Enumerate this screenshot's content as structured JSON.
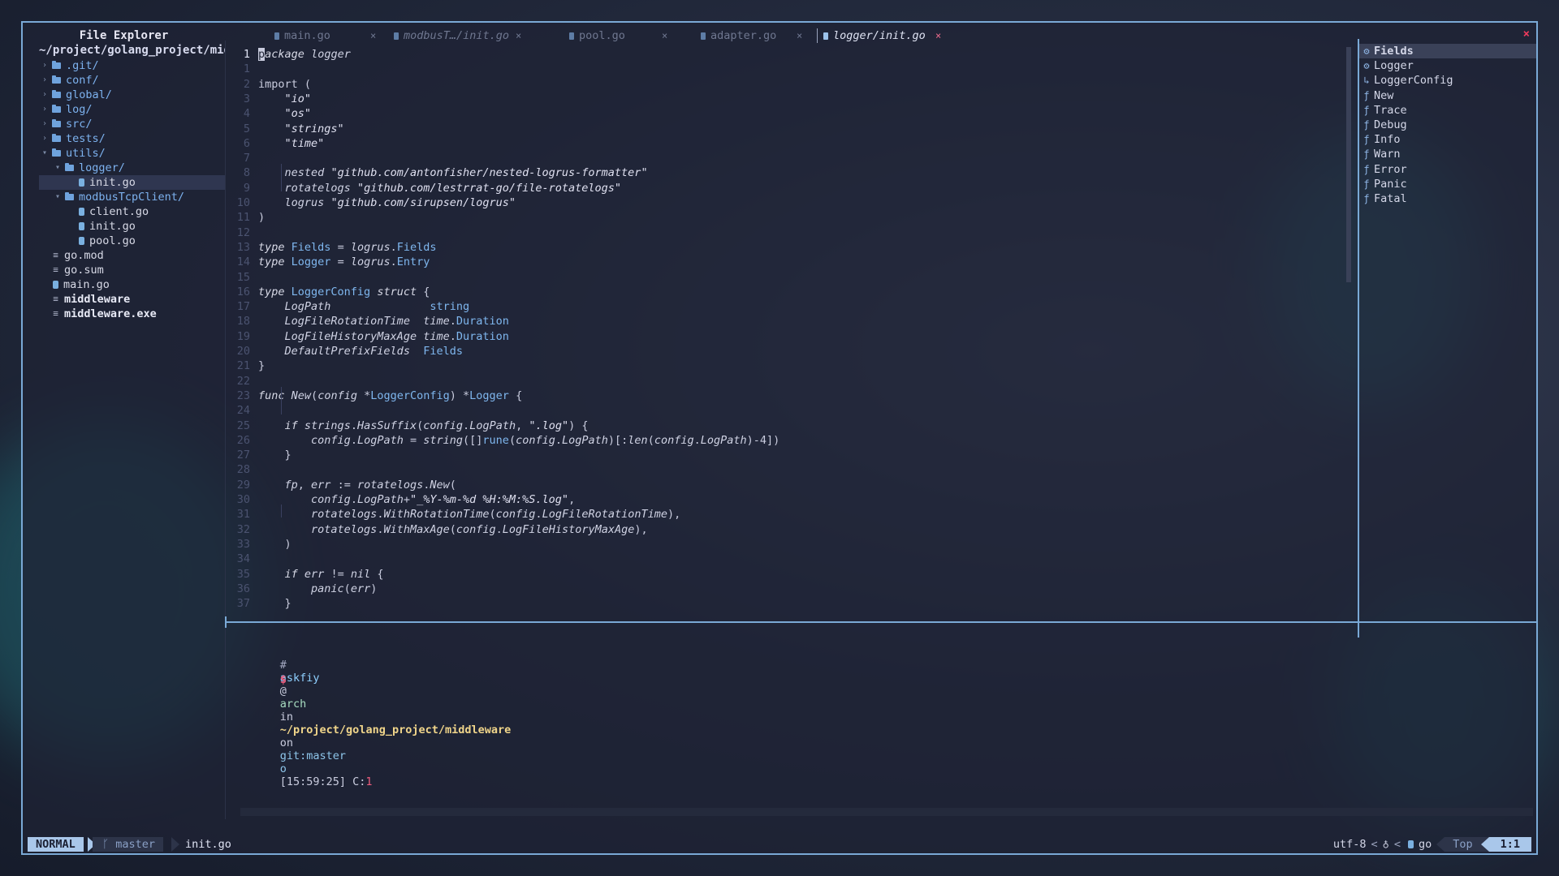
{
  "explorer": {
    "title": "File Explorer",
    "path": "~/project/golang_project/mid",
    "items": [
      {
        "label": ".git/",
        "type": "dir",
        "depth": 0,
        "open": false
      },
      {
        "label": "conf/",
        "type": "dir",
        "depth": 0,
        "open": false
      },
      {
        "label": "global/",
        "type": "dir",
        "depth": 0,
        "open": false
      },
      {
        "label": "log/",
        "type": "dir",
        "depth": 0,
        "open": false
      },
      {
        "label": "src/",
        "type": "dir",
        "depth": 0,
        "open": false
      },
      {
        "label": "tests/",
        "type": "dir",
        "depth": 0,
        "open": false
      },
      {
        "label": "utils/",
        "type": "dir",
        "depth": 0,
        "open": true
      },
      {
        "label": "logger/",
        "type": "dir",
        "depth": 1,
        "open": true
      },
      {
        "label": "init.go",
        "type": "go",
        "depth": 2,
        "selected": true
      },
      {
        "label": "modbusTcpClient/",
        "type": "dir",
        "depth": 1,
        "open": true
      },
      {
        "label": "client.go",
        "type": "go",
        "depth": 2
      },
      {
        "label": "init.go",
        "type": "go",
        "depth": 2
      },
      {
        "label": "pool.go",
        "type": "go",
        "depth": 2
      },
      {
        "label": "go.mod",
        "type": "file",
        "depth": 0
      },
      {
        "label": "go.sum",
        "type": "file",
        "depth": 0
      },
      {
        "label": "main.go",
        "type": "go",
        "depth": 0
      },
      {
        "label": "middleware",
        "type": "file",
        "depth": 0,
        "bold": true
      },
      {
        "label": "middleware.exe",
        "type": "file",
        "depth": 0,
        "bold": true
      }
    ]
  },
  "tabs": [
    {
      "label": "main.go",
      "active": false
    },
    {
      "label": "modbusT…/init.go",
      "active": false
    },
    {
      "label": "pool.go",
      "active": false
    },
    {
      "label": "adapter.go",
      "active": false
    },
    {
      "label": "logger/init.go",
      "active": true
    }
  ],
  "tab_close_glyph": "×",
  "window_close_glyph": "×",
  "code": [
    {
      "n": "1",
      "cur": true,
      "t": [
        [
          "cursor",
          "p"
        ],
        [
          "kw",
          "ackage"
        ],
        [
          "plain",
          " "
        ],
        [
          "id",
          "logger"
        ]
      ]
    },
    {
      "n": "1",
      "t": []
    },
    {
      "n": "2",
      "t": [
        [
          "plain",
          "import ("
        ]
      ]
    },
    {
      "n": "3",
      "t": [
        [
          "plain",
          "    "
        ],
        [
          "str",
          "\"io\""
        ]
      ]
    },
    {
      "n": "4",
      "t": [
        [
          "plain",
          "    "
        ],
        [
          "str",
          "\"os\""
        ]
      ]
    },
    {
      "n": "5",
      "t": [
        [
          "plain",
          "    "
        ],
        [
          "str",
          "\"strings\""
        ]
      ]
    },
    {
      "n": "6",
      "t": [
        [
          "plain",
          "    "
        ],
        [
          "str",
          "\"time\""
        ]
      ]
    },
    {
      "n": "7",
      "t": []
    },
    {
      "n": "8",
      "t": [
        [
          "plain",
          "    "
        ],
        [
          "id",
          "nested"
        ],
        [
          "plain",
          " "
        ],
        [
          "str",
          "\"github.com/antonfisher/nested-logrus-formatter\""
        ]
      ]
    },
    {
      "n": "9",
      "t": [
        [
          "plain",
          "    "
        ],
        [
          "id",
          "rotatelogs"
        ],
        [
          "plain",
          " "
        ],
        [
          "str",
          "\"github.com/lestrrat-go/file-rotatelogs\""
        ]
      ]
    },
    {
      "n": "10",
      "t": [
        [
          "plain",
          "    "
        ],
        [
          "id",
          "logrus"
        ],
        [
          "plain",
          " "
        ],
        [
          "str",
          "\"github.com/sirupsen/logrus\""
        ]
      ]
    },
    {
      "n": "11",
      "t": [
        [
          "plain",
          ")"
        ]
      ]
    },
    {
      "n": "12",
      "t": []
    },
    {
      "n": "13",
      "t": [
        [
          "kw",
          "type"
        ],
        [
          "plain",
          " "
        ],
        [
          "ty",
          "Fields"
        ],
        [
          "plain",
          " = "
        ],
        [
          "id",
          "logrus"
        ],
        [
          "plain",
          "."
        ],
        [
          "ty",
          "Fields"
        ]
      ]
    },
    {
      "n": "14",
      "t": [
        [
          "kw",
          "type"
        ],
        [
          "plain",
          " "
        ],
        [
          "ty",
          "Logger"
        ],
        [
          "plain",
          " = "
        ],
        [
          "id",
          "logrus"
        ],
        [
          "plain",
          "."
        ],
        [
          "ty",
          "Entry"
        ]
      ]
    },
    {
      "n": "15",
      "t": []
    },
    {
      "n": "16",
      "t": [
        [
          "kw",
          "type"
        ],
        [
          "plain",
          " "
        ],
        [
          "ty",
          "LoggerConfig"
        ],
        [
          "plain",
          " "
        ],
        [
          "kw",
          "struct"
        ],
        [
          "plain",
          " {"
        ]
      ]
    },
    {
      "n": "17",
      "t": [
        [
          "plain",
          "    "
        ],
        [
          "id",
          "LogPath"
        ],
        [
          "plain",
          "               "
        ],
        [
          "ty",
          "string"
        ]
      ]
    },
    {
      "n": "18",
      "t": [
        [
          "plain",
          "    "
        ],
        [
          "id",
          "LogFileRotationTime"
        ],
        [
          "plain",
          "  "
        ],
        [
          "id",
          "time"
        ],
        [
          "plain",
          "."
        ],
        [
          "ty",
          "Duration"
        ]
      ]
    },
    {
      "n": "19",
      "t": [
        [
          "plain",
          "    "
        ],
        [
          "id",
          "LogFileHistoryMaxAge"
        ],
        [
          "plain",
          " "
        ],
        [
          "id",
          "time"
        ],
        [
          "plain",
          "."
        ],
        [
          "ty",
          "Duration"
        ]
      ]
    },
    {
      "n": "20",
      "t": [
        [
          "plain",
          "    "
        ],
        [
          "id",
          "DefaultPrefixFields"
        ],
        [
          "plain",
          "  "
        ],
        [
          "ty",
          "Fields"
        ]
      ]
    },
    {
      "n": "21",
      "t": [
        [
          "plain",
          "}"
        ]
      ]
    },
    {
      "n": "22",
      "t": []
    },
    {
      "n": "23",
      "t": [
        [
          "kw",
          "func"
        ],
        [
          "plain",
          " "
        ],
        [
          "id",
          "New"
        ],
        [
          "plain",
          "("
        ],
        [
          "id",
          "config"
        ],
        [
          "plain",
          " *"
        ],
        [
          "ty",
          "LoggerConfig"
        ],
        [
          "plain",
          ") *"
        ],
        [
          "ty",
          "Logger"
        ],
        [
          "plain",
          " {"
        ]
      ]
    },
    {
      "n": "24",
      "t": []
    },
    {
      "n": "25",
      "t": [
        [
          "plain",
          "    "
        ],
        [
          "kw",
          "if"
        ],
        [
          "plain",
          " "
        ],
        [
          "id",
          "strings"
        ],
        [
          "plain",
          "."
        ],
        [
          "id",
          "HasSuffix"
        ],
        [
          "plain",
          "("
        ],
        [
          "id",
          "config"
        ],
        [
          "plain",
          "."
        ],
        [
          "id",
          "LogPath"
        ],
        [
          "plain",
          ", "
        ],
        [
          "str",
          "\".log\""
        ],
        [
          "plain",
          ") {"
        ]
      ]
    },
    {
      "n": "26",
      "t": [
        [
          "plain",
          "        "
        ],
        [
          "id",
          "config"
        ],
        [
          "plain",
          "."
        ],
        [
          "id",
          "LogPath"
        ],
        [
          "plain",
          " = "
        ],
        [
          "id",
          "string"
        ],
        [
          "plain",
          "([]"
        ],
        [
          "ty",
          "rune"
        ],
        [
          "plain",
          "("
        ],
        [
          "id",
          "config"
        ],
        [
          "plain",
          "."
        ],
        [
          "id",
          "LogPath"
        ],
        [
          "plain",
          ")[:"
        ],
        [
          "id",
          "len"
        ],
        [
          "plain",
          "("
        ],
        [
          "id",
          "config"
        ],
        [
          "plain",
          "."
        ],
        [
          "id",
          "LogPath"
        ],
        [
          "plain",
          ")-4])"
        ]
      ]
    },
    {
      "n": "27",
      "t": [
        [
          "plain",
          "    }"
        ]
      ]
    },
    {
      "n": "28",
      "t": []
    },
    {
      "n": "29",
      "t": [
        [
          "plain",
          "    "
        ],
        [
          "id",
          "fp"
        ],
        [
          "plain",
          ", "
        ],
        [
          "id",
          "err"
        ],
        [
          "plain",
          " := "
        ],
        [
          "id",
          "rotatelogs"
        ],
        [
          "plain",
          "."
        ],
        [
          "id",
          "New"
        ],
        [
          "plain",
          "("
        ]
      ]
    },
    {
      "n": "30",
      "t": [
        [
          "plain",
          "        "
        ],
        [
          "id",
          "config"
        ],
        [
          "plain",
          "."
        ],
        [
          "id",
          "LogPath"
        ],
        [
          "plain",
          "+"
        ],
        [
          "str",
          "\"_%Y-%m-%d %H:%M:%S.log\""
        ],
        [
          "plain",
          ","
        ]
      ]
    },
    {
      "n": "31",
      "t": [
        [
          "plain",
          "        "
        ],
        [
          "id",
          "rotatelogs"
        ],
        [
          "plain",
          "."
        ],
        [
          "id",
          "WithRotationTime"
        ],
        [
          "plain",
          "("
        ],
        [
          "id",
          "config"
        ],
        [
          "plain",
          "."
        ],
        [
          "id",
          "LogFileRotationTime"
        ],
        [
          "plain",
          "),"
        ]
      ]
    },
    {
      "n": "32",
      "t": [
        [
          "plain",
          "        "
        ],
        [
          "id",
          "rotatelogs"
        ],
        [
          "plain",
          "."
        ],
        [
          "id",
          "WithMaxAge"
        ],
        [
          "plain",
          "("
        ],
        [
          "id",
          "config"
        ],
        [
          "plain",
          "."
        ],
        [
          "id",
          "LogFileHistoryMaxAge"
        ],
        [
          "plain",
          "),"
        ]
      ]
    },
    {
      "n": "33",
      "t": [
        [
          "plain",
          "    )"
        ]
      ]
    },
    {
      "n": "34",
      "t": []
    },
    {
      "n": "35",
      "t": [
        [
          "plain",
          "    "
        ],
        [
          "kw",
          "if"
        ],
        [
          "plain",
          " "
        ],
        [
          "id",
          "err"
        ],
        [
          "plain",
          " != "
        ],
        [
          "id",
          "nil"
        ],
        [
          "plain",
          " {"
        ]
      ]
    },
    {
      "n": "36",
      "t": [
        [
          "plain",
          "        "
        ],
        [
          "id",
          "panic"
        ],
        [
          "plain",
          "("
        ],
        [
          "id",
          "err"
        ],
        [
          "plain",
          ")"
        ]
      ]
    },
    {
      "n": "37",
      "t": [
        [
          "plain",
          "    }"
        ]
      ]
    }
  ],
  "outline": [
    {
      "label": "Fields",
      "icon": "gear-icon",
      "glyph": "⚙",
      "selected": true
    },
    {
      "label": "Logger",
      "icon": "gear-icon",
      "glyph": "⚙"
    },
    {
      "label": "LoggerConfig",
      "icon": "struct-icon",
      "glyph": "↳"
    },
    {
      "label": "New",
      "icon": "function-icon",
      "glyph": "ƒ"
    },
    {
      "label": "Trace",
      "icon": "function-icon",
      "glyph": "ƒ"
    },
    {
      "label": "Debug",
      "icon": "function-icon",
      "glyph": "ƒ"
    },
    {
      "label": "Info",
      "icon": "function-icon",
      "glyph": "ƒ"
    },
    {
      "label": "Warn",
      "icon": "function-icon",
      "glyph": "ƒ"
    },
    {
      "label": "Error",
      "icon": "function-icon",
      "glyph": "ƒ"
    },
    {
      "label": "Panic",
      "icon": "function-icon",
      "glyph": "ƒ"
    },
    {
      "label": "Fatal",
      "icon": "function-icon",
      "glyph": "ƒ"
    }
  ],
  "terminal": {
    "hash": "#",
    "user": "askfiy",
    "at": "@",
    "host": "arch",
    "in": "in",
    "path": "~/project/golang_project/middleware",
    "on": "on",
    "git": "git:master",
    "git_status": "o",
    "time": "[15:59:25]",
    "code_label": "C:",
    "code_value": "1",
    "prompt": "$"
  },
  "statusline": {
    "mode": "NORMAL",
    "branch_glyph": "ᚴ",
    "branch": "master",
    "filename": "init.go",
    "encoding": "utf-8",
    "sep": "<",
    "lsp_glyph": "♁",
    "filetype": "go",
    "position": "Top",
    "cursor": "1:1"
  },
  "colors": {
    "accent": "#7aa9d6",
    "close": "#ef3a5d",
    "string": "#dfe0f0",
    "type": "#7fb7ef",
    "folder": "#6fa3dd"
  }
}
